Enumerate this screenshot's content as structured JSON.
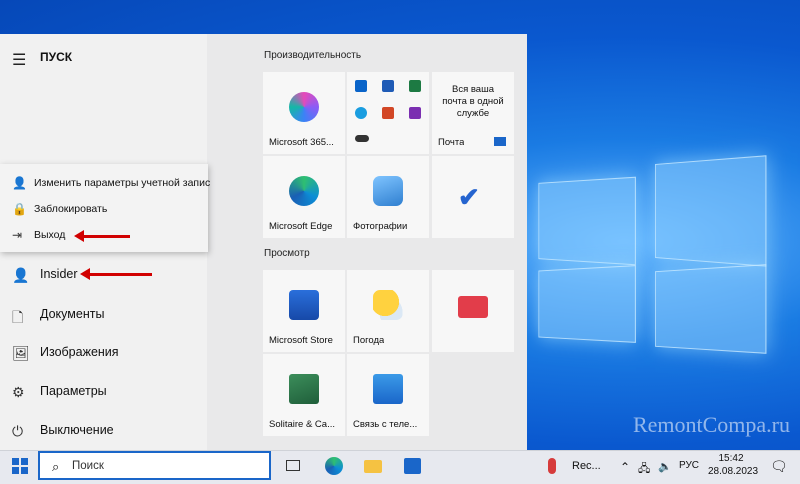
{
  "start_menu": {
    "title": "ПУСК",
    "account_menu": [
      {
        "icon": "person-gear-icon",
        "label": "Изменить параметры учетной запис"
      },
      {
        "icon": "lock-icon",
        "label": "Заблокировать"
      },
      {
        "icon": "sign-out-icon",
        "label": "Выход"
      }
    ],
    "nav": [
      {
        "icon": "user-icon",
        "label": "Insider"
      },
      {
        "icon": "document-icon",
        "label": "Документы"
      },
      {
        "icon": "pictures-icon",
        "label": "Изображения"
      },
      {
        "icon": "gear-icon",
        "label": "Параметры"
      },
      {
        "icon": "power-icon",
        "label": "Выключение"
      }
    ],
    "groups": [
      {
        "label": "Производительность"
      },
      {
        "label": "Просмотр"
      }
    ],
    "tiles": {
      "m365": "Microsoft 365...",
      "mail_text": "Вся ваша почта в одной службе",
      "mail": "Почта",
      "edge": "Microsoft Edge",
      "photos": "Фотографии",
      "store": "Microsoft Store",
      "weather": "Погода",
      "solitaire": "Solitaire & Ca...",
      "phone": "Связь с теле..."
    }
  },
  "taskbar": {
    "search_placeholder": "Поиск",
    "tray_app": "Rec...",
    "lang": "РУС",
    "time": "15:42",
    "date": "28.08.2023"
  },
  "watermark": "RemontCompa.ru",
  "colors": {
    "accent": "#1a66c9",
    "arrow": "#d10000"
  }
}
